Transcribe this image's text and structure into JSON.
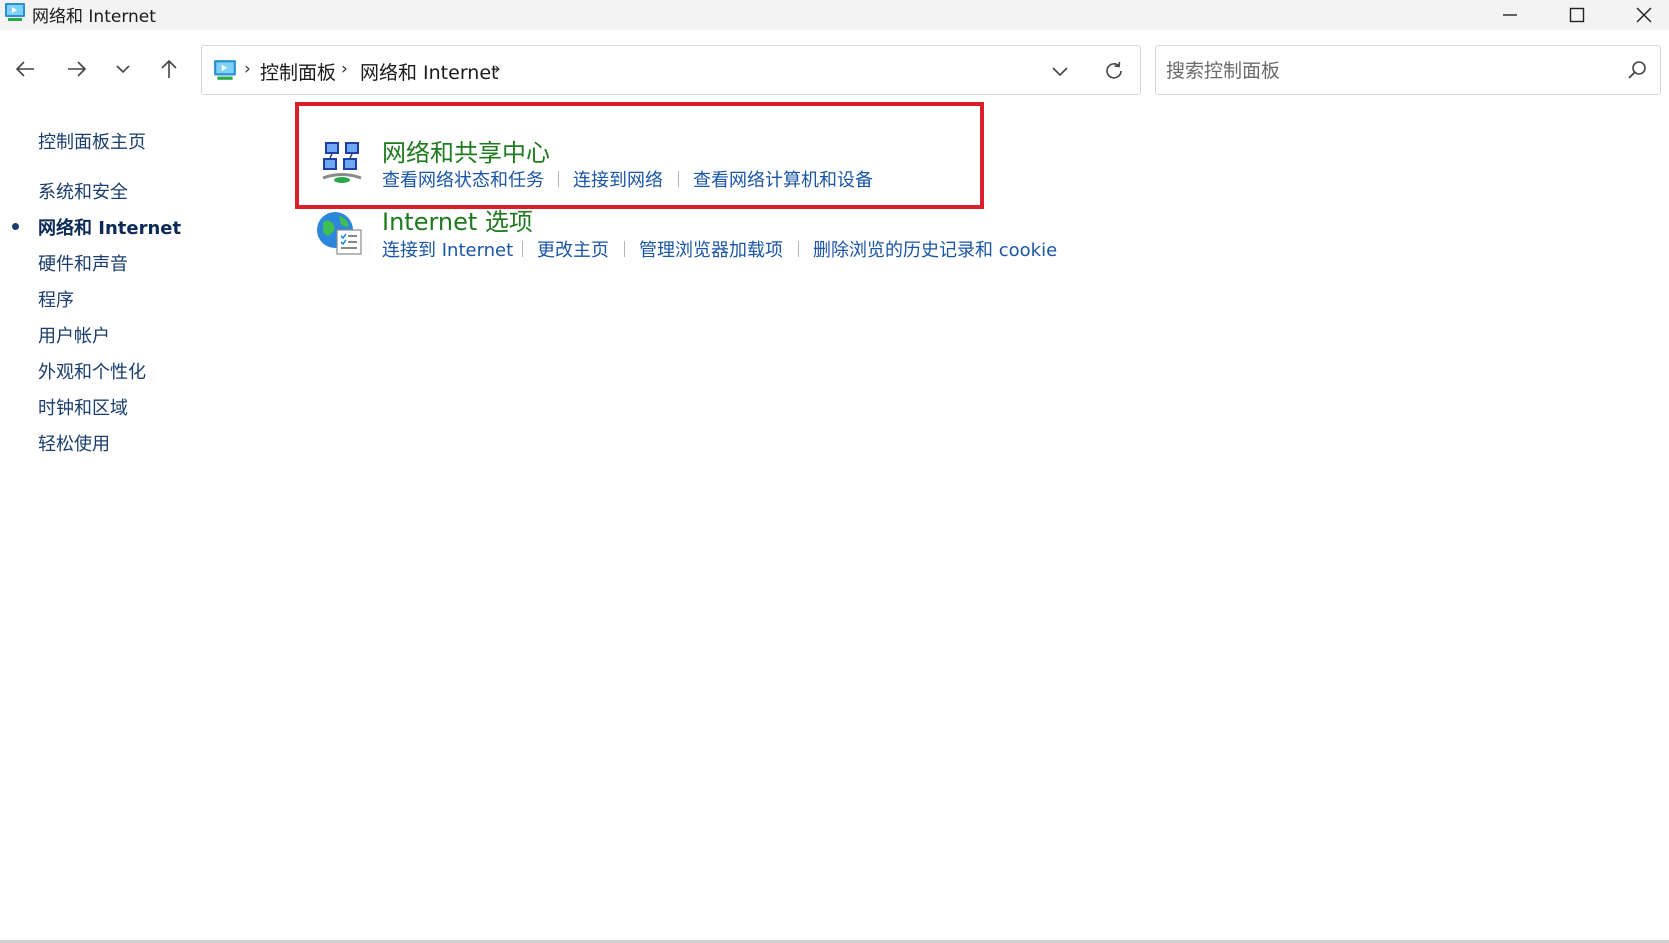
{
  "window": {
    "title": "网络和 Internet"
  },
  "address": {
    "crumbs": [
      "控制面板",
      "网络和 Internet"
    ]
  },
  "search": {
    "placeholder": "搜索控制面板"
  },
  "sidebar": {
    "items": [
      {
        "label": "控制面板主页",
        "active": false
      },
      {
        "label": "系统和安全",
        "active": false
      },
      {
        "label": "网络和 Internet",
        "active": true
      },
      {
        "label": "硬件和声音",
        "active": false
      },
      {
        "label": "程序",
        "active": false
      },
      {
        "label": "用户帐户",
        "active": false
      },
      {
        "label": "外观和个性化",
        "active": false
      },
      {
        "label": "时钟和区域",
        "active": false
      },
      {
        "label": "轻松使用",
        "active": false
      }
    ]
  },
  "categories": [
    {
      "title": "网络和共享中心",
      "icon": "network-sharing-center-icon",
      "links": [
        "查看网络状态和任务",
        "连接到网络",
        "查看网络计算机和设备"
      ],
      "highlighted": true
    },
    {
      "title": "Internet 选项",
      "icon": "internet-options-icon",
      "links": [
        "连接到 Internet",
        "更改主页",
        "管理浏览器加载项",
        "删除浏览的历史记录和 cookie"
      ]
    }
  ],
  "colors": {
    "category_title": "#1e7a1e",
    "link": "#1a55a6",
    "highlight_border": "#d9202a"
  }
}
